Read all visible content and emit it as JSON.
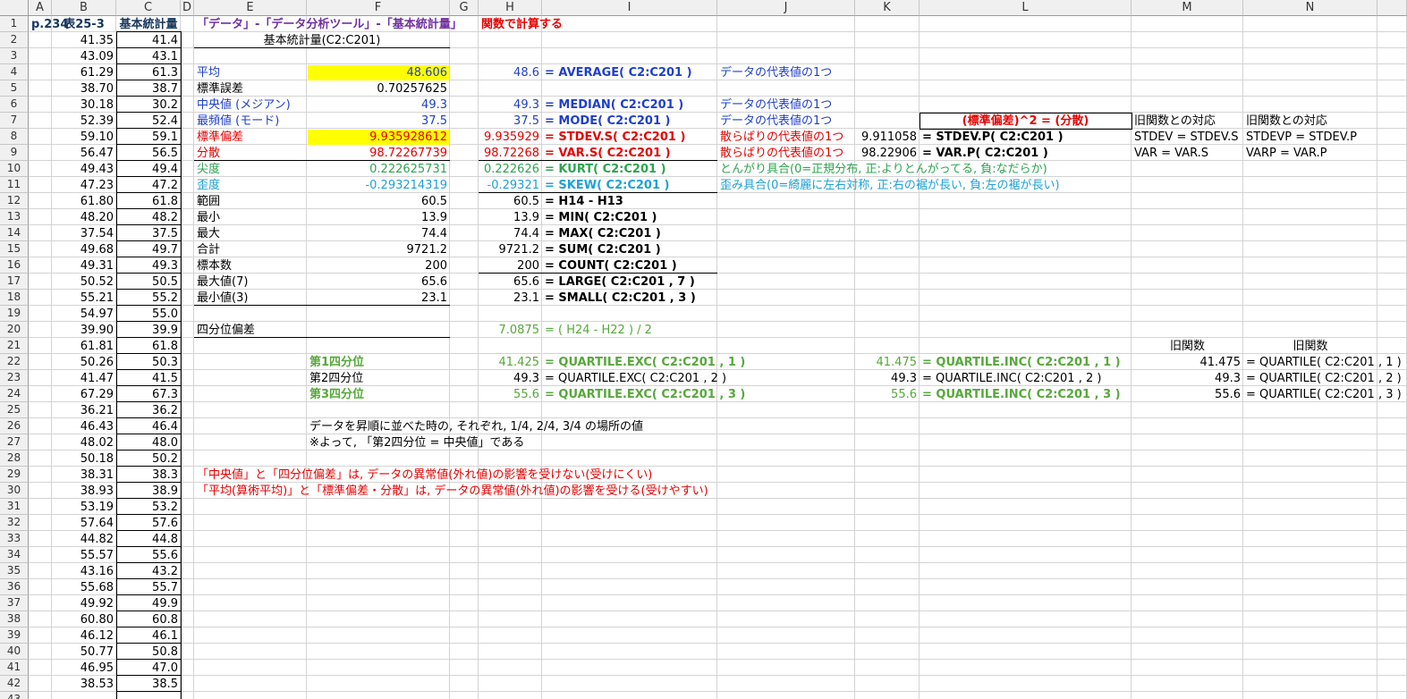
{
  "columns": [
    "A",
    "B",
    "C",
    "D",
    "E",
    "F",
    "G",
    "H",
    "I",
    "J",
    "K",
    "L",
    "M",
    "N"
  ],
  "rows": [
    "1",
    "2",
    "3",
    "4",
    "5",
    "6",
    "7",
    "8",
    "9",
    "10",
    "11",
    "12",
    "13",
    "14",
    "15",
    "16",
    "17",
    "18",
    "19",
    "20",
    "21",
    "22",
    "23",
    "24",
    "25",
    "26",
    "27",
    "28",
    "29",
    "30",
    "31",
    "32",
    "33",
    "34",
    "35",
    "36",
    "37",
    "38",
    "39",
    "40",
    "41",
    "42",
    "43"
  ],
  "header_row": {
    "a1": "p.234",
    "b1": "表25-3",
    "c1": "基本統計量",
    "e1": "「データ」-「データ分析ツール」-「基本統計量」",
    "h1": "関数で計算する"
  },
  "col_b": [
    "41.35",
    "43.09",
    "61.29",
    "38.70",
    "30.18",
    "52.39",
    "59.10",
    "56.47",
    "49.43",
    "47.23",
    "61.80",
    "48.20",
    "37.54",
    "49.68",
    "49.31",
    "50.52",
    "55.21",
    "54.97",
    "39.90",
    "61.81",
    "50.26",
    "41.47",
    "67.29",
    "36.21",
    "46.43",
    "48.02",
    "50.18",
    "38.31",
    "38.93",
    "53.19",
    "57.64",
    "44.82",
    "55.57",
    "43.16",
    "55.68",
    "49.92",
    "60.80",
    "46.12",
    "50.77",
    "46.95",
    "38.53"
  ],
  "col_c": [
    "41.4",
    "43.1",
    "61.3",
    "38.7",
    "30.2",
    "52.4",
    "59.1",
    "56.5",
    "49.4",
    "47.2",
    "61.8",
    "48.2",
    "37.5",
    "49.7",
    "49.3",
    "50.5",
    "55.2",
    "55.0",
    "39.9",
    "61.8",
    "50.3",
    "41.5",
    "67.3",
    "36.2",
    "46.4",
    "48.0",
    "50.2",
    "38.3",
    "38.9",
    "53.2",
    "57.6",
    "44.8",
    "55.6",
    "43.2",
    "55.7",
    "49.9",
    "60.8",
    "46.1",
    "50.8",
    "47.0",
    "38.5"
  ],
  "stats_title": "基本統計量(C2:C201)",
  "stats": [
    {
      "label": "平均",
      "value": "48.606",
      "h": "48.6",
      "i": "= AVERAGE( C2:C201 )",
      "j": "データの代表値の1つ"
    },
    {
      "label": "標準誤差",
      "value": "0.70257625",
      "h": "",
      "i": "",
      "j": ""
    },
    {
      "label": "中央値 (メジアン)",
      "value": "49.3",
      "h": "49.3",
      "i": "= MEDIAN( C2:C201 )",
      "j": "データの代表値の1つ"
    },
    {
      "label": "最頻値 (モード)",
      "value": "37.5",
      "h": "37.5",
      "i": "= MODE( C2:C201 )",
      "j": "データの代表値の1つ"
    },
    {
      "label": "標準偏差",
      "value": "9.935928612",
      "h": "9.935929",
      "i": "= STDEV.S( C2:C201 )",
      "j": "散らばりの代表値の1つ"
    },
    {
      "label": "分散",
      "value": "98.72267739",
      "h": "98.72268",
      "i": "= VAR.S( C2:C201 )",
      "j": "散らばりの代表値の1つ"
    },
    {
      "label": "尖度",
      "value": "0.222625731",
      "h": "0.222626",
      "i": "= KURT( C2:C201 )",
      "j": "とんがり具合(0=正規分布, 正:よりとんがってる, 負:なだらか)"
    },
    {
      "label": "歪度",
      "value": "-0.293214319",
      "h": "-0.29321",
      "i": "= SKEW( C2:C201 )",
      "j": "歪み具合(0=綺麗に左右対称, 正:右の裾が長い, 負:左の裾が長い)"
    },
    {
      "label": "範囲",
      "value": "60.5",
      "h": "60.5",
      "i": "= H14 - H13",
      "j": ""
    },
    {
      "label": "最小",
      "value": "13.9",
      "h": "13.9",
      "i": "= MIN( C2:C201 )",
      "j": ""
    },
    {
      "label": "最大",
      "value": "74.4",
      "h": "74.4",
      "i": "= MAX( C2:C201 )",
      "j": ""
    },
    {
      "label": "合計",
      "value": "9721.2",
      "h": "9721.2",
      "i": "= SUM( C2:C201 )",
      "j": ""
    },
    {
      "label": "標本数",
      "value": "200",
      "h": "200",
      "i": "= COUNT( C2:C201 )",
      "j": ""
    },
    {
      "label": "最大値(7)",
      "value": "65.6",
      "h": "65.6",
      "i": "= LARGE( C2:C201 , 7 )",
      "j": ""
    },
    {
      "label": "最小値(3)",
      "value": "23.1",
      "h": "23.1",
      "i": "= SMALL( C2:C201 , 3 )",
      "j": ""
    }
  ],
  "right_block": {
    "l7": "(標準偏差)^2 = (分散)",
    "m7": "旧関数との対応",
    "n7": "旧関数との対応",
    "k8": "9.911058",
    "l8": "= STDEV.P( C2:C201 )",
    "m8": "STDEV = STDEV.S",
    "n8": "STDEVP = STDEV.P",
    "k9": "98.22906",
    "l9": "= VAR.P( C2:C201 )",
    "m9": "VAR = VAR.S",
    "n9": "VARP = VAR.P"
  },
  "quartile": {
    "e20": "四分位偏差",
    "h20": "7.0875",
    "i20": "= ( H24 - H22 ) / 2",
    "m21": "旧関数",
    "n21": "旧関数",
    "rows": [
      {
        "f": "第1四分位",
        "h": "41.425",
        "i": "= QUARTILE.EXC( C2:C201 , 1 )",
        "k": "41.475",
        "l": "= QUARTILE.INC( C2:C201 , 1 )",
        "m": "41.475",
        "n": "= QUARTILE( C2:C201 , 1 )"
      },
      {
        "f": "第2四分位",
        "h": "49.3",
        "i": "= QUARTILE.EXC( C2:C201 , 2 )",
        "k": "49.3",
        "l": "= QUARTILE.INC( C2:C201 , 2 )",
        "m": "49.3",
        "n": "= QUARTILE( C2:C201 , 2 )"
      },
      {
        "f": "第3四分位",
        "h": "55.6",
        "i": "= QUARTILE.EXC( C2:C201 , 3 )",
        "k": "55.6",
        "l": "= QUARTILE.INC( C2:C201 , 3 )",
        "m": "55.6",
        "n": "= QUARTILE( C2:C201 , 3 )"
      }
    ]
  },
  "notes": {
    "f26": "データを昇順に並べた時の, それぞれ, 1/4, 2/4, 3/4 の場所の値",
    "f27": "※よって, 「第2四分位 = 中央値」である",
    "e29": "「中央値」と「四分位偏差」は, データの異常値(外れ値)の影響を受けない(受けにくい)",
    "e30": "「平均(算術平均)」と「標準偏差・分散」は, データの異常値(外れ値)の影響を受ける(受けやすい)"
  }
}
